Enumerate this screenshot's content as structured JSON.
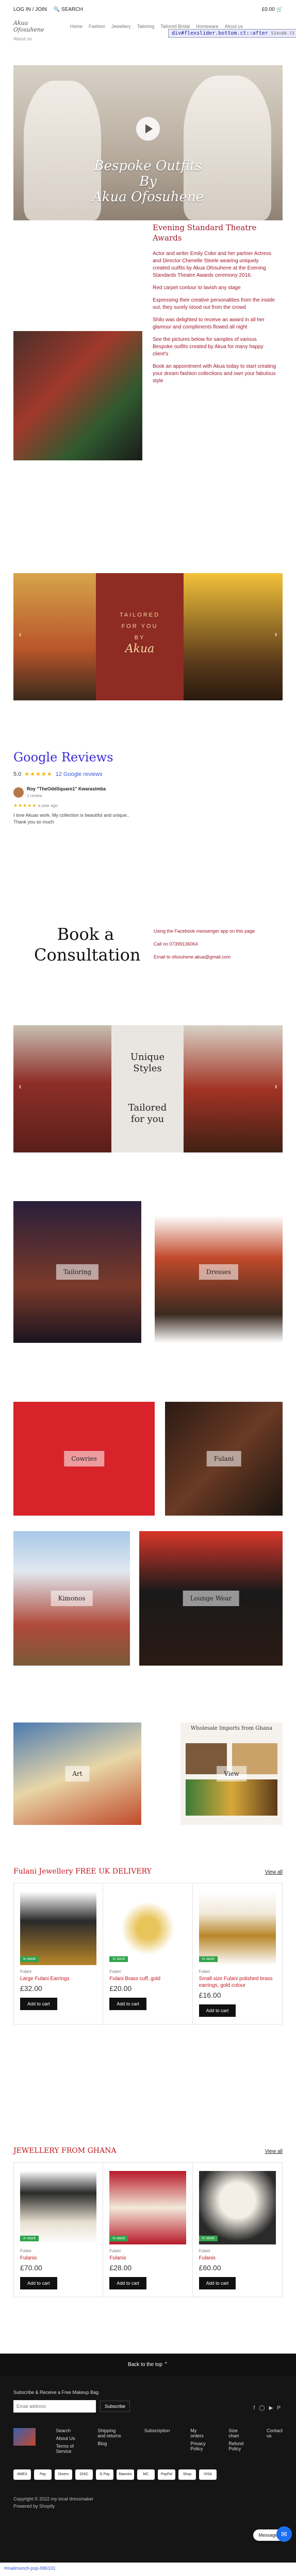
{
  "header": {
    "login": "LOG IN / JOIN",
    "search": "SEARCH",
    "cart_amount": "£0.00",
    "logo": "Akua Ofosuhene",
    "nav": [
      "Home",
      "Fashion",
      "Jewellery",
      "Tailoring",
      "Tailored Bridal",
      "Homeware",
      "About us"
    ],
    "subnav": "About us"
  },
  "debug": {
    "selector": "div#flexslider.bottom.ct::after",
    "size": "514×80.73"
  },
  "hero": {
    "title_line1": "Bespoke Outfits",
    "title_line2": "By",
    "title_line3": "Akua Ofosuhene"
  },
  "theatre": {
    "heading": "Evening Standard Theatre Awards",
    "paragraphs": [
      "Actor and writer Emily Coke and her partner Actress and Director Chenelle Steele wearing uniquely created outfits by Akua Ofosuhene at the Evening Standards Theatre Awards ceremony 2016.",
      "Red carpet contour to lavish any stage",
      "Expressing their creative personalities from the inside out, they surely stood out from the crowd",
      "Shilo was delighted to receive an award in all her glamour and compliments flowed all night",
      "See the pictures below for samples of various Bespoke outfits created by Akua for many happy client's",
      "Book an appointment with Akua today to start creating your dream fashion collections and own your fabulous style"
    ]
  },
  "tailored_banner": {
    "line1": "TAILORED",
    "line2": "FOR YOU",
    "line3": "BY",
    "script": "Akua"
  },
  "reviews": {
    "heading": "Google Reviews",
    "score": "5.0",
    "stars": "★★★★★",
    "count_link": "12 Google reviews",
    "reviewer": "Roy \"TheOddSquare1\" Kwarasimba",
    "reviewer_meta": "1 review",
    "review_stars": "★★★★★",
    "review_age": "a year ago",
    "text_line1": "I love Akuas work. My collection is beautiful and unique..",
    "text_line2": "Thank you so much"
  },
  "consult": {
    "heading_line1": "Book a",
    "heading_line2": "Consultation",
    "info": [
      "Using the Facebook messenger app on this page",
      "Call on 07399136064",
      "Email to ofosuhene.akua@gmail.com"
    ]
  },
  "unique": {
    "line1": "Unique",
    "line2": "Styles",
    "line3": "Tailored",
    "line4": "for you"
  },
  "categories": {
    "tailoring": "Tailoring",
    "dresses": "Dresses",
    "cowries": "Cowries",
    "fulani": "Fulani",
    "kimonos": "Kimonos",
    "lounge": "Lounge Wear",
    "art": "Art",
    "view": "View",
    "wholesale": "Wholesale Imports from Ghana"
  },
  "fulani_collection": {
    "heading": "Fulani Jewellery FREE UK DELIVERY",
    "view_all": "View all",
    "products": [
      {
        "badge": "In stock",
        "vendor": "Fulani",
        "name": "Large Fulani Earrings",
        "price": "£32.00",
        "button": "Add to cart"
      },
      {
        "badge": "In stock",
        "vendor": "Fulani",
        "name": "Fulani Brass cuff, gold",
        "price": "£20.00",
        "button": "Add to cart"
      },
      {
        "badge": "In stock",
        "vendor": "Fulani",
        "name": "Small size Fulani polished brass earrings, gold colour",
        "price": "£16.00",
        "button": "Add to cart"
      }
    ]
  },
  "ghana_collection": {
    "heading": "JEWELLERY FROM GHANA",
    "view_all": "View all",
    "products": [
      {
        "badge": "In stock",
        "vendor": "Fulani",
        "name": "Fulanis",
        "price": "£70.00",
        "button": "Add to cart"
      },
      {
        "badge": "In stock",
        "vendor": "Fulani",
        "name": "Fulanis",
        "price": "£28.00",
        "button": "Add to cart"
      },
      {
        "badge": "In stock",
        "vendor": "Fulani",
        "name": "Fulanis",
        "price": "£60.00",
        "button": "Add to cart"
      }
    ]
  },
  "footer": {
    "back_to_top": "Back to the top ⌃",
    "subscribe_title": "Subscribe & Receive a Free Makeup Bag",
    "email_placeholder": "Email address",
    "subscribe_button": "Subscribe",
    "links_col1": [
      "Search",
      "About Us",
      "Terms of Service"
    ],
    "links_col2": [
      "Shipping and returns",
      "Blog"
    ],
    "links_col3": [
      "Subscription"
    ],
    "links_col4": [
      "My orders",
      "Privacy Policy"
    ],
    "links_col5": [
      "Size chart",
      "Refund Policy"
    ],
    "links_col6": [
      "Contact us"
    ],
    "payment": [
      "AMEX",
      "Pay",
      "Diners",
      "DISC",
      "G Pay",
      "Maestro",
      "MC",
      "PayPal",
      "Shop",
      "VISA"
    ],
    "copyright": "Copyright © 2022 my local dressmaker",
    "powered": "Powered by Shopify",
    "message_us": "Message us"
  },
  "bottom_bar": "#mailmunch-pop-996101",
  "colors": {
    "accent_red": "#c0161e",
    "google_blue": "#3c2bd6",
    "stock_green": "#2fa34a"
  }
}
